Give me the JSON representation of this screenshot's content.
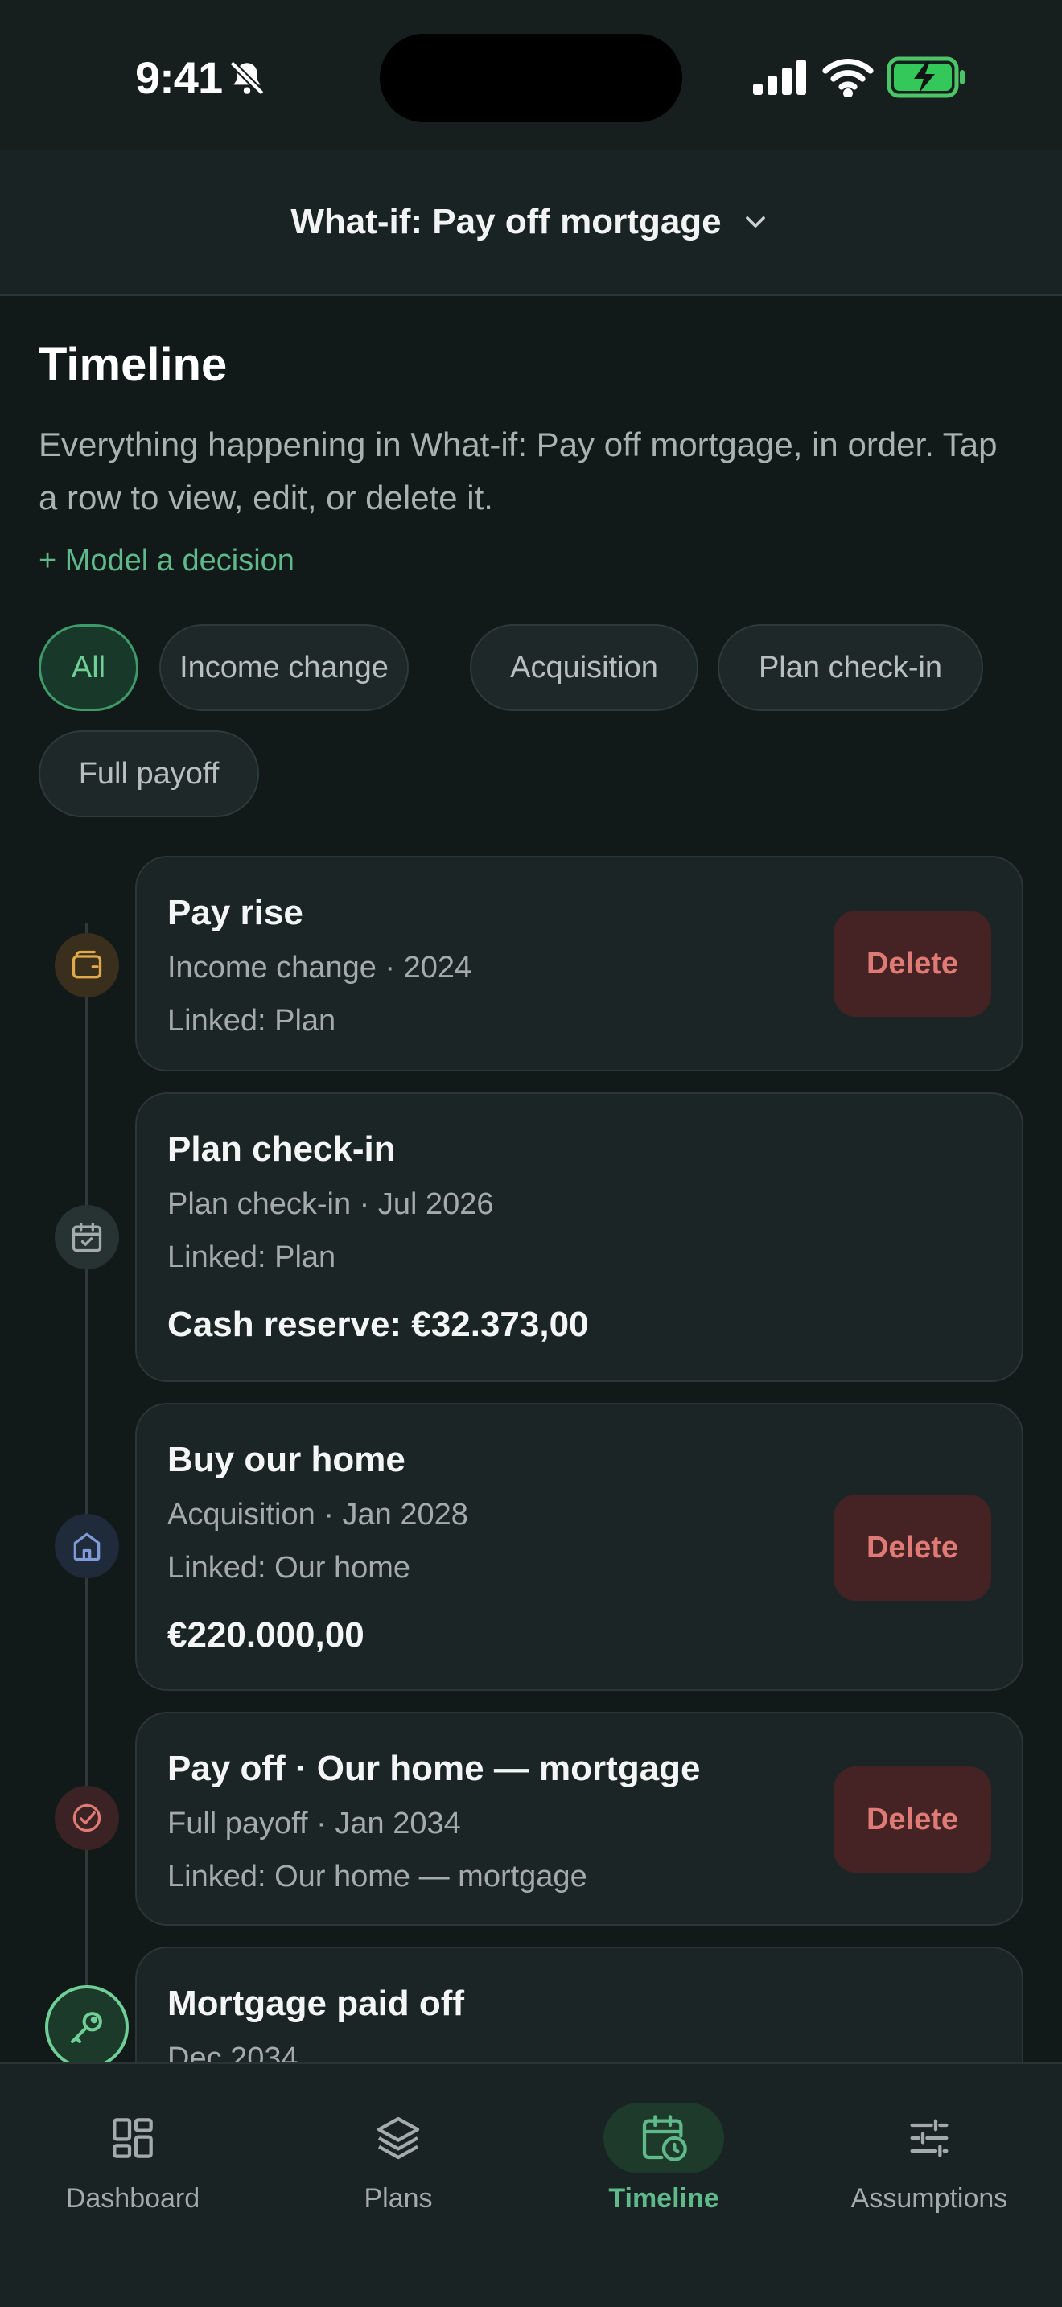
{
  "status": {
    "time": "9:41"
  },
  "scenario": {
    "title": "What-if: Pay off mortgage"
  },
  "page": {
    "title": "Timeline",
    "description": "Everything happening in What-if: Pay off mortgage, in order. Tap a row to view, edit, or delete it.",
    "model_link": "+ Model a decision"
  },
  "filters": [
    {
      "label": "All",
      "active": true
    },
    {
      "label": "Income change",
      "active": false
    },
    {
      "label": "Acquisition",
      "active": false
    },
    {
      "label": "Plan check-in",
      "active": false
    },
    {
      "label": "Full payoff",
      "active": false
    }
  ],
  "events": [
    {
      "title": "Pay rise",
      "subtitle": "Income change · 2024",
      "linked": "Linked: Plan",
      "value": "",
      "delete_label": "Delete",
      "icon": "wallet-icon"
    },
    {
      "title": "Plan check-in",
      "subtitle": "Plan check-in · Jul 2026",
      "linked": "Linked: Plan",
      "value": "Cash reserve: €32.373,00",
      "delete_label": "",
      "icon": "calendar-check-icon"
    },
    {
      "title": "Buy our home",
      "subtitle": "Acquisition · Jan 2028",
      "linked": "Linked: Our home",
      "value": "€220.000,00",
      "delete_label": "Delete",
      "icon": "home-icon"
    },
    {
      "title": "Pay off · Our home — mortgage",
      "subtitle": "Full payoff · Jan 2034",
      "linked": "Linked: Our home — mortgage",
      "value": "",
      "delete_label": "Delete",
      "icon": "check-circle-icon"
    },
    {
      "title": "Mortgage paid off",
      "subtitle": "Dec 2034",
      "linked": "",
      "value": "",
      "delete_label": "",
      "icon": "key-icon"
    }
  ],
  "nav": [
    {
      "label": "Dashboard",
      "icon": "grid-icon",
      "active": false
    },
    {
      "label": "Plans",
      "icon": "layers-icon",
      "active": false
    },
    {
      "label": "Timeline",
      "icon": "calendar-clock-icon",
      "active": true
    },
    {
      "label": "Assumptions",
      "icon": "sliders-icon",
      "active": false
    }
  ],
  "colors": {
    "accent": "#5fb98a",
    "danger_bg": "#452325",
    "danger_text": "#e07a74",
    "wallet": "#e0a94a",
    "home": "#7f9bd6",
    "payoff": "#e07a74",
    "milestone": "#6fcf97"
  }
}
